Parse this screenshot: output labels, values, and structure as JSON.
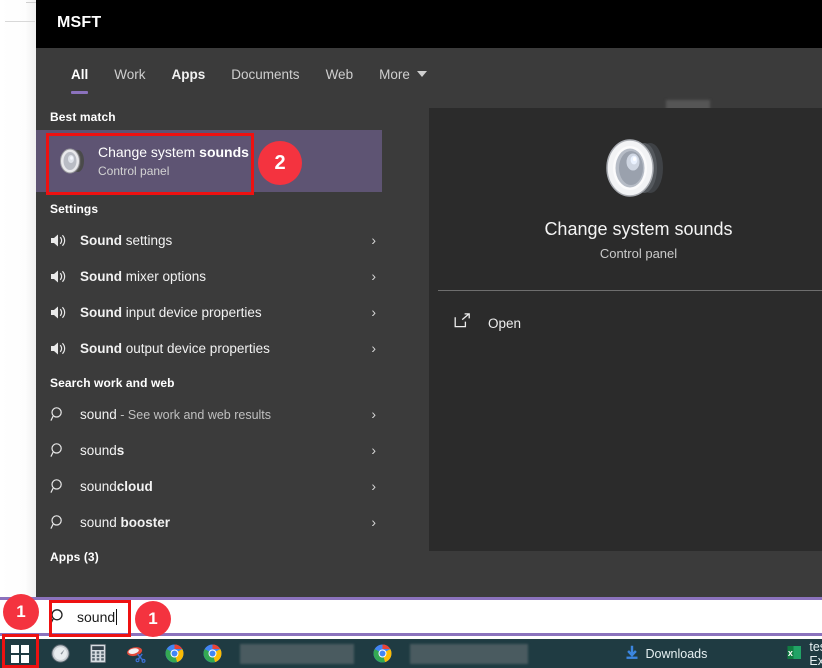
{
  "header": {
    "title": "MSFT",
    "tabs": [
      {
        "label": "All",
        "active": true
      },
      {
        "label": "Work",
        "active": false
      },
      {
        "label": "Apps",
        "active": false
      },
      {
        "label": "Documents",
        "active": false
      },
      {
        "label": "Web",
        "active": false
      },
      {
        "label": "More",
        "active": false
      }
    ],
    "overflow_icon": "ellipsis-icon",
    "close_icon": "close-icon",
    "avatar": "account-avatar-blurred"
  },
  "results": {
    "best_match": {
      "group_label": "Best match",
      "title_normal": "Change system ",
      "title_bold": "sounds",
      "subtitle": "Control panel",
      "icon": "speaker-icon"
    },
    "settings": {
      "group_label": "Settings",
      "items": [
        {
          "bold": "Sound",
          "rest": " settings",
          "icon": "speaker-icon",
          "chevron": "chevron-right-icon"
        },
        {
          "bold": "Sound",
          "rest": " mixer options",
          "icon": "speaker-icon",
          "chevron": "chevron-right-icon"
        },
        {
          "bold": "Sound",
          "rest": " input device properties",
          "icon": "speaker-icon",
          "chevron": "chevron-right-icon"
        },
        {
          "bold": "Sound",
          "rest": " output device properties",
          "icon": "speaker-icon",
          "chevron": "chevron-right-icon"
        }
      ]
    },
    "web": {
      "group_label": "Search work and web",
      "items": [
        {
          "prefix": "sound",
          "bold": "",
          "suffix": " - See work and web results",
          "icon": "search-icon",
          "chevron": "chevron-right-icon"
        },
        {
          "prefix": "sound",
          "bold": "s",
          "suffix": "",
          "icon": "search-icon",
          "chevron": "chevron-right-icon"
        },
        {
          "prefix": "sound",
          "bold": "cloud",
          "suffix": "",
          "icon": "search-icon",
          "chevron": "chevron-right-icon"
        },
        {
          "prefix": "sound ",
          "bold": "booster",
          "suffix": "",
          "icon": "search-icon",
          "chevron": "chevron-right-icon"
        }
      ]
    },
    "apps": {
      "group_label": "Apps (3)"
    }
  },
  "preview": {
    "icon": "speaker-icon-large",
    "title": "Change system sounds",
    "subtitle": "Control panel",
    "action_label": "Open",
    "action_icon": "open-external-icon"
  },
  "search": {
    "value": "sound",
    "icon": "search-icon"
  },
  "taskbar": {
    "start_icon": "windows-start-icon",
    "icons": [
      {
        "name": "clock-compass-icon"
      },
      {
        "name": "calculator-icon"
      },
      {
        "name": "snipping-tool-icon"
      },
      {
        "name": "chrome-icon"
      },
      {
        "name": "chrome-icon"
      },
      {
        "name": "blurred-window-group"
      },
      {
        "name": "chrome-icon"
      },
      {
        "name": "blurred-window-group"
      }
    ],
    "items": [
      {
        "label": "Downloads",
        "icon": "download-arrow-icon"
      },
      {
        "label": "test.xlsm - Excel",
        "icon": "excel-icon"
      }
    ]
  },
  "annotations": {
    "badge_start": "1",
    "badge_search": "1",
    "badge_bestmatch": "2",
    "accent_red": "#ee1111",
    "badge_red": "#f4333f",
    "accent_purple": "#8b72bd"
  }
}
